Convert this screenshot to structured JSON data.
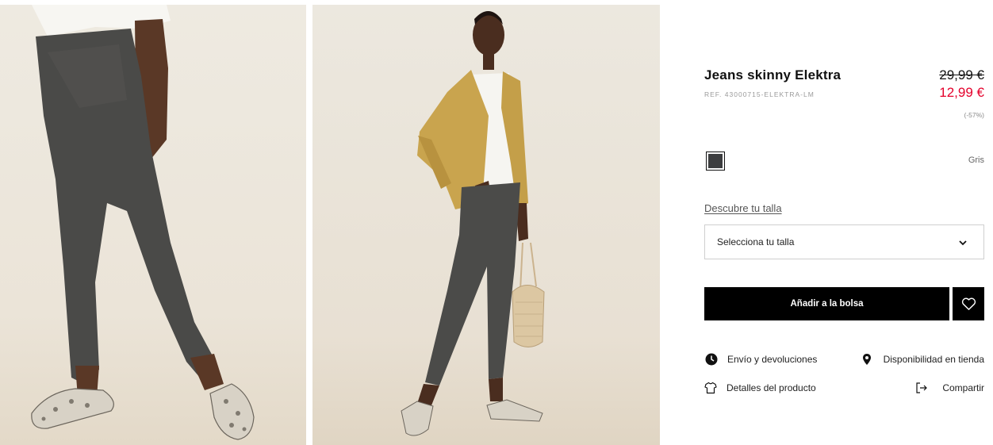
{
  "product": {
    "title": "Jeans skinny Elektra",
    "reference": "REF. 43000715-ELEKTRA-LM",
    "old_price": "29,99 €",
    "price": "12,99 €",
    "discount": "(-57%)"
  },
  "colors": {
    "selected_name": "Gris",
    "swatch_color": "#3d3e40"
  },
  "size": {
    "guide_label": "Descubre tu talla",
    "select_placeholder": "Selecciona tu talla"
  },
  "actions": {
    "add_to_bag": "Añadir a la bolsa"
  },
  "links": {
    "shipping": "Envío y devoluciones",
    "availability": "Disponibilidad en tienda",
    "details": "Detalles del producto",
    "share": "Compartir"
  },
  "theme": {
    "sale_red": "#e4002b",
    "button_black": "#000000"
  }
}
